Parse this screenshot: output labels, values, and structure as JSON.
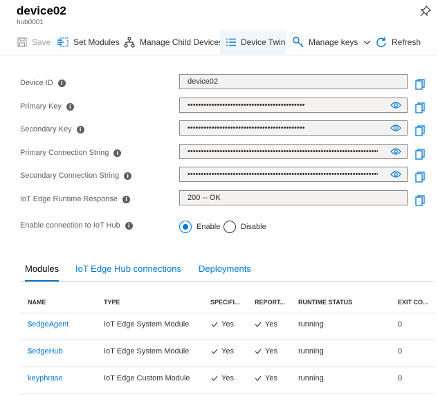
{
  "header": {
    "title": "device02",
    "subtitle": "hub0001"
  },
  "toolbar": {
    "save": "Save",
    "set_modules": "Set Modules",
    "manage_child_devices": "Manage Child Devices",
    "device_twin": "Device Twin",
    "manage_keys": "Manage keys",
    "refresh": "Refresh"
  },
  "properties": [
    {
      "label": "Device ID",
      "value": "device02"
    },
    {
      "label": "Primary Key",
      "value": "••••••••••••••••••••••••••••••••••••••••••••"
    },
    {
      "label": "Secondary Key",
      "value": "••••••••••••••••••••••••••••••••••••••••••••"
    },
    {
      "label": "Primary Connection String",
      "value": "••••••••••••••••••••••••••••••••••••••••••••••••••••••••••••••••••••••••••••••..."
    },
    {
      "label": "Secondary Connection String",
      "value": "••••••••••••••••••••••••••••••••••••••••••••••••••••••••••••••••••••••••••••••..."
    },
    {
      "label": "IoT Edge Runtime Response",
      "value": "200 -- OK"
    }
  ],
  "connection": {
    "label": "Enable connection to IoT Hub",
    "enable": "Enable",
    "disable": "Disable",
    "selected": "Enable"
  },
  "tabs": [
    "Modules",
    "IoT Edge Hub connections",
    "Deployments"
  ],
  "modules_table": {
    "headers": [
      "NAME",
      "TYPE",
      "SPECIFI...",
      "REPORT...",
      "RUNTIME STATUS",
      "EXIT CO..."
    ],
    "rows": [
      {
        "name": "$edgeAgent",
        "type": "IoT Edge System Module",
        "specified": "Yes",
        "reported": "Yes",
        "status": "running",
        "exit_code": "0"
      },
      {
        "name": "$edgeHub",
        "type": "IoT Edge System Module",
        "specified": "Yes",
        "reported": "Yes",
        "status": "running",
        "exit_code": "0"
      },
      {
        "name": "keyphrase",
        "type": "IoT Edge Custom Module",
        "specified": "Yes",
        "reported": "Yes",
        "status": "running",
        "exit_code": "0"
      }
    ]
  },
  "colors": {
    "accent": "#0078d4",
    "field_bg": "#f3f2f1",
    "active_tab_bg": "#eff6fc"
  },
  "icons": [
    "pin-icon",
    "save-icon",
    "set-modules-icon",
    "child-devices-icon",
    "device-twin-icon",
    "key-icon",
    "chevron-down-icon",
    "refresh-icon",
    "info-icon",
    "eye-icon",
    "copy-icon",
    "checkmark-icon"
  ]
}
